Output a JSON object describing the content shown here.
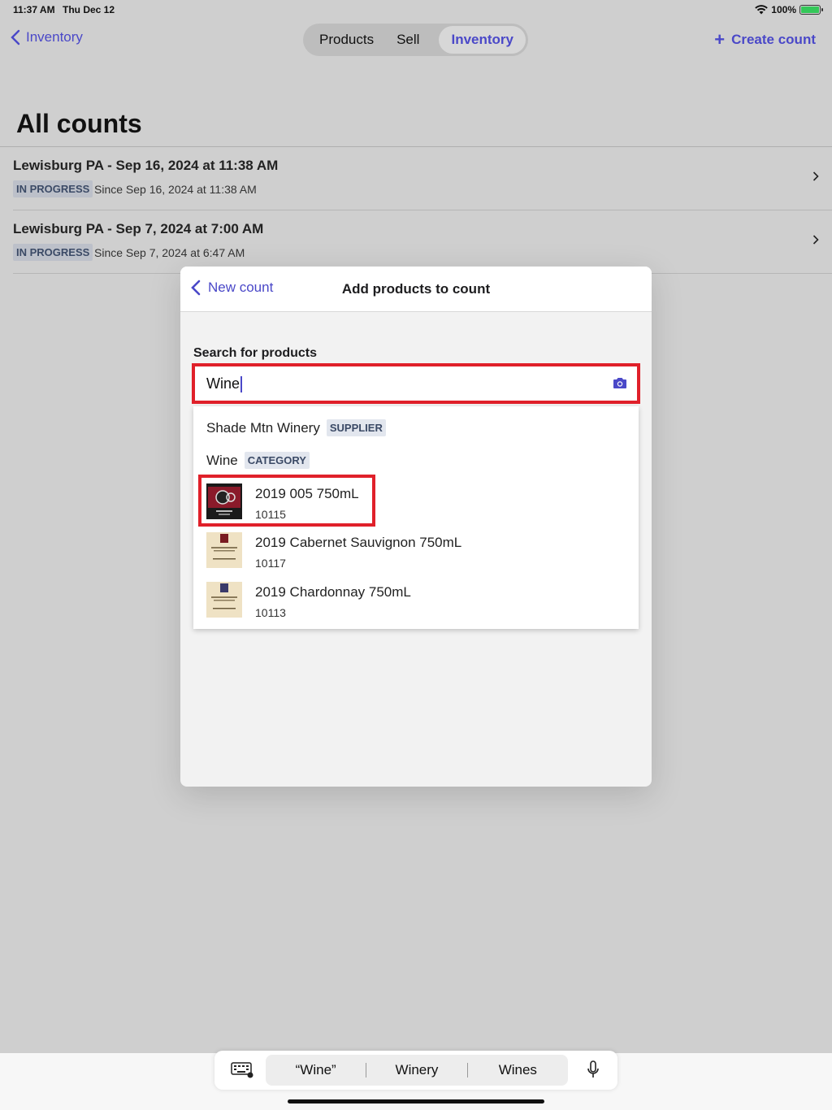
{
  "status_bar": {
    "time": "11:37 AM",
    "date": "Thu Dec 12",
    "battery": "100%"
  },
  "nav": {
    "back_label": "Inventory",
    "segments": [
      "Products",
      "Sell",
      "Inventory"
    ],
    "active_segment": "Inventory",
    "create_label": "Create count"
  },
  "page": {
    "title": "All counts"
  },
  "counts": [
    {
      "title": "Lewisburg PA - Sep 16, 2024 at 11:38 AM",
      "status": "IN PROGRESS",
      "since": "Since Sep 16, 2024 at 11:38 AM"
    },
    {
      "title": "Lewisburg PA - Sep 7, 2024 at 7:00 AM",
      "status": "IN PROGRESS",
      "since": "Since Sep 7, 2024 at 6:47 AM"
    }
  ],
  "modal": {
    "back_label": "New count",
    "title": "Add products to count",
    "search_label": "Search for products",
    "search_value": "Wine",
    "suggestions": [
      {
        "name": "Shade Mtn Winery",
        "tag": "SUPPLIER"
      },
      {
        "name": "Wine",
        "tag": "CATEGORY"
      }
    ],
    "products": [
      {
        "name": "2019 005 750mL",
        "sku": "10115"
      },
      {
        "name": "2019 Cabernet Sauvignon 750mL",
        "sku": "10117"
      },
      {
        "name": "2019 Chardonnay 750mL",
        "sku": "10113"
      }
    ]
  },
  "keyboard": {
    "suggestions": [
      "“Wine”",
      "Winery",
      "Wines"
    ]
  },
  "colors": {
    "accent": "#4a48c8",
    "highlight": "#e0202a",
    "badge_bg": "#bcc0c9",
    "battery": "#34c759"
  }
}
